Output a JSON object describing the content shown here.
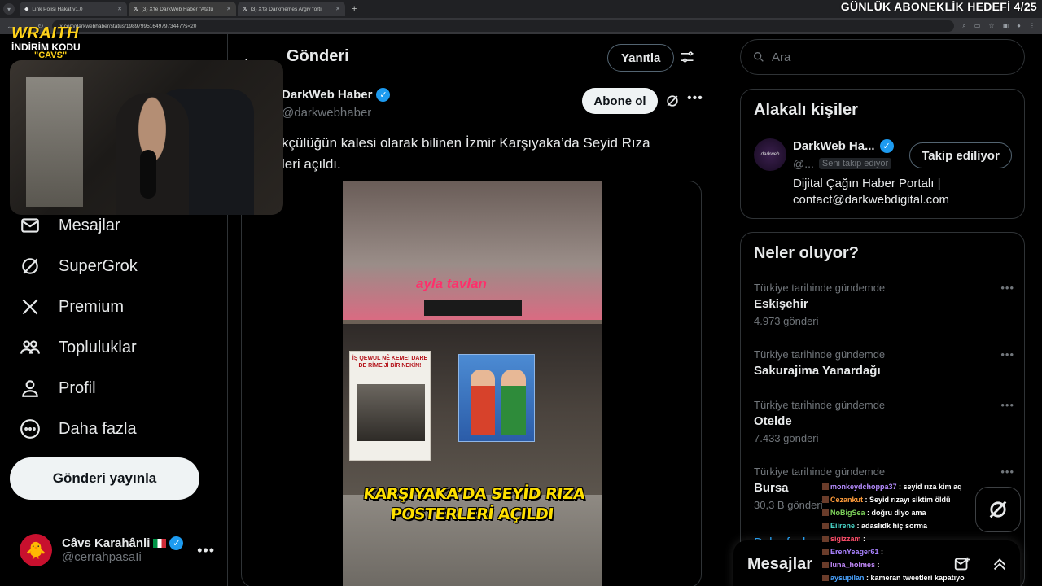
{
  "browser": {
    "tabs": [
      {
        "label": "Link Polisi Hakat v1.0",
        "active": false
      },
      {
        "label": "(3) X'te DarkWeb Haber \"Atatü",
        "active": true
      },
      {
        "label": "(3) X'te Darkmemes Argiv \"ortı",
        "active": false
      }
    ],
    "url": "x.com/darkwebhaber/status/1989799516497973447?s=20"
  },
  "overlay": {
    "subscription_goal": "GÜNLÜK ABONEKLİK HEDEFİ 4/25",
    "brand_name": "WRAITH",
    "brand_discount": "İNDİRİM KODU",
    "brand_code": "\"CAVS\""
  },
  "nav": {
    "items": [
      {
        "label": "Mesajlar",
        "icon": "mail-icon"
      },
      {
        "label": "SuperGrok",
        "icon": "grok-icon"
      },
      {
        "label": "Premium",
        "icon": "x-logo-icon"
      },
      {
        "label": "Topluluklar",
        "icon": "communities-icon"
      },
      {
        "label": "Profil",
        "icon": "profile-icon"
      },
      {
        "label": "Daha fazla",
        "icon": "more-circle-icon"
      }
    ],
    "post_button": "Gönderi yayınla",
    "account": {
      "name": "Câvs Karahânli",
      "handle": "@cerrahpasaIi"
    }
  },
  "main": {
    "title": "Gönderi",
    "reply_button": "Yanıtla",
    "author": {
      "name": "DarkWeb Haber",
      "handle": "@darkwebhaber"
    },
    "subscribe_button": "Abone ol",
    "post_text": "kçülüğün kalesi olarak bilinen İzmir Karşıyaka’da Seyid Rıza\nleri açıldı.",
    "video": {
      "shop_sign": "ayla tavlan",
      "banner_text": "İŞ QEWUL NÊ KEME! DARE DE RİME Jİ BİR NEKİN!",
      "caption": "KARŞIYAKA’DA SEYİD RIZA POSTERLERİ AÇILDI"
    }
  },
  "sidebar": {
    "search_placeholder": "Ara",
    "relevant": {
      "title": "Alakalı kişiler",
      "name": "DarkWeb Ha...",
      "handle": "@...",
      "follows_you": "Seni takip ediyor",
      "follow_button": "Takip ediliyor",
      "bio": "Dijital Çağın Haber Portalı | contact@darkwebdigital.com"
    },
    "trends": {
      "title": "Neler oluyor?",
      "items": [
        {
          "context": "Türkiye tarihinde gündemde",
          "name": "Eskişehir",
          "count": "4.973 gönderi"
        },
        {
          "context": "Türkiye tarihinde gündemde",
          "name": "Sakurajima Yanardağı",
          "count": ""
        },
        {
          "context": "Türkiye tarihinde gündemde",
          "name": "Otelde",
          "count": "7.433 gönderi"
        },
        {
          "context": "Türkiye tarihinde gündemde",
          "name": "Bursa",
          "count": "30,3 B gönderi"
        }
      ],
      "show_more": "Daha fazla göster"
    },
    "messages_title": "Mesajlar"
  },
  "chat": [
    {
      "user": "monkeydchoppa37",
      "color": "#b58cff",
      "text": "seyid rıza kim aq"
    },
    {
      "user": "Cezankut",
      "color": "#ff9c3a",
      "text": "Seyid rızayı siktim öldü"
    },
    {
      "user": "NoBigSea",
      "color": "#7dd35a",
      "text": "doğru diyo ama"
    },
    {
      "user": "Eiirene",
      "color": "#49d6c9",
      "text": "adaslıdk hiç sorma"
    },
    {
      "user": "sigizzam",
      "color": "#ff4e6a",
      "text": ""
    },
    {
      "user": "ErenYeager61",
      "color": "#a982ff",
      "text": ""
    },
    {
      "user": "luna_holmes",
      "color": "#c58bff",
      "text": ""
    },
    {
      "user": "aysupilan",
      "color": "#4aa3ff",
      "text": "kameran tweetleri kapatıyo"
    }
  ]
}
